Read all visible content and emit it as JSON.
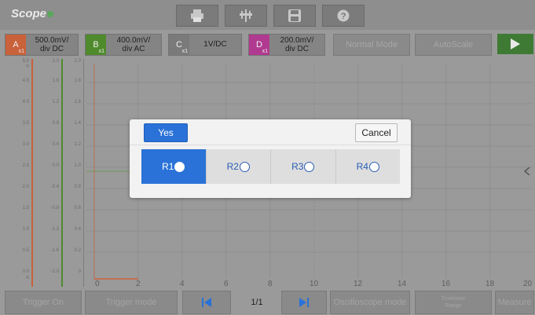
{
  "app": {
    "logo": "Scope"
  },
  "toolbar": {
    "icons": [
      "print-icon",
      "marker-icon",
      "save-icon",
      "help-icon"
    ]
  },
  "channels": [
    {
      "id": "A",
      "sub": "x1",
      "value_line1": "500.0mV/",
      "value_line2": "div DC",
      "color": "#d8683a"
    },
    {
      "id": "B",
      "sub": "x1",
      "value_line1": "400.0mV/",
      "value_line2": "div AC",
      "color": "#5a9a2f"
    },
    {
      "id": "C",
      "sub": "x1",
      "value_line1": "1V/DC",
      "value_line2": "",
      "color": "#8a8a8a"
    },
    {
      "id": "D",
      "sub": "x1",
      "value_line1": "200.0mV/",
      "value_line2": "div DC",
      "color": "#c0389a"
    }
  ],
  "mode": {
    "normal_label": "Normal Mode",
    "auto_label": "AutoScale"
  },
  "plot": {
    "a_scale": [
      "5.0",
      "4.5",
      "4.0",
      "3.5",
      "3.0",
      "2.5",
      "2.0",
      "1.5",
      "1.0",
      "0.5",
      "0.0"
    ],
    "a_unit_top": "V",
    "a_unit_bottom": "A",
    "b_scale": [
      "2.0",
      "1.6",
      "1.2",
      "0.8",
      "0.4",
      "0.0",
      "-0.4",
      "-0.8",
      "-1.2",
      "-1.6",
      "-2.0"
    ],
    "c_scale": [
      "2.0",
      "1.8",
      "1.6",
      "1.4",
      "1.2",
      "1.0",
      "0.8",
      "0.6",
      "0.4",
      "0.2",
      "0"
    ],
    "x_ticks": [
      "0",
      "2",
      "4",
      "6",
      "8",
      "10",
      "12",
      "14",
      "16",
      "18",
      "20"
    ]
  },
  "bottom": {
    "trigger_on": "Trigger On",
    "trigger_mode": "Trigger mode",
    "page": "1/1",
    "osc_mode": "Oscilloscope mode",
    "timebase_line1": "Timebase",
    "timebase_line2": "Range",
    "measure": "Measure"
  },
  "dialog": {
    "yes_label": "Yes",
    "cancel_label": "Cancel",
    "options": [
      "R1",
      "R2",
      "R3",
      "R4"
    ],
    "selected": "R1"
  }
}
